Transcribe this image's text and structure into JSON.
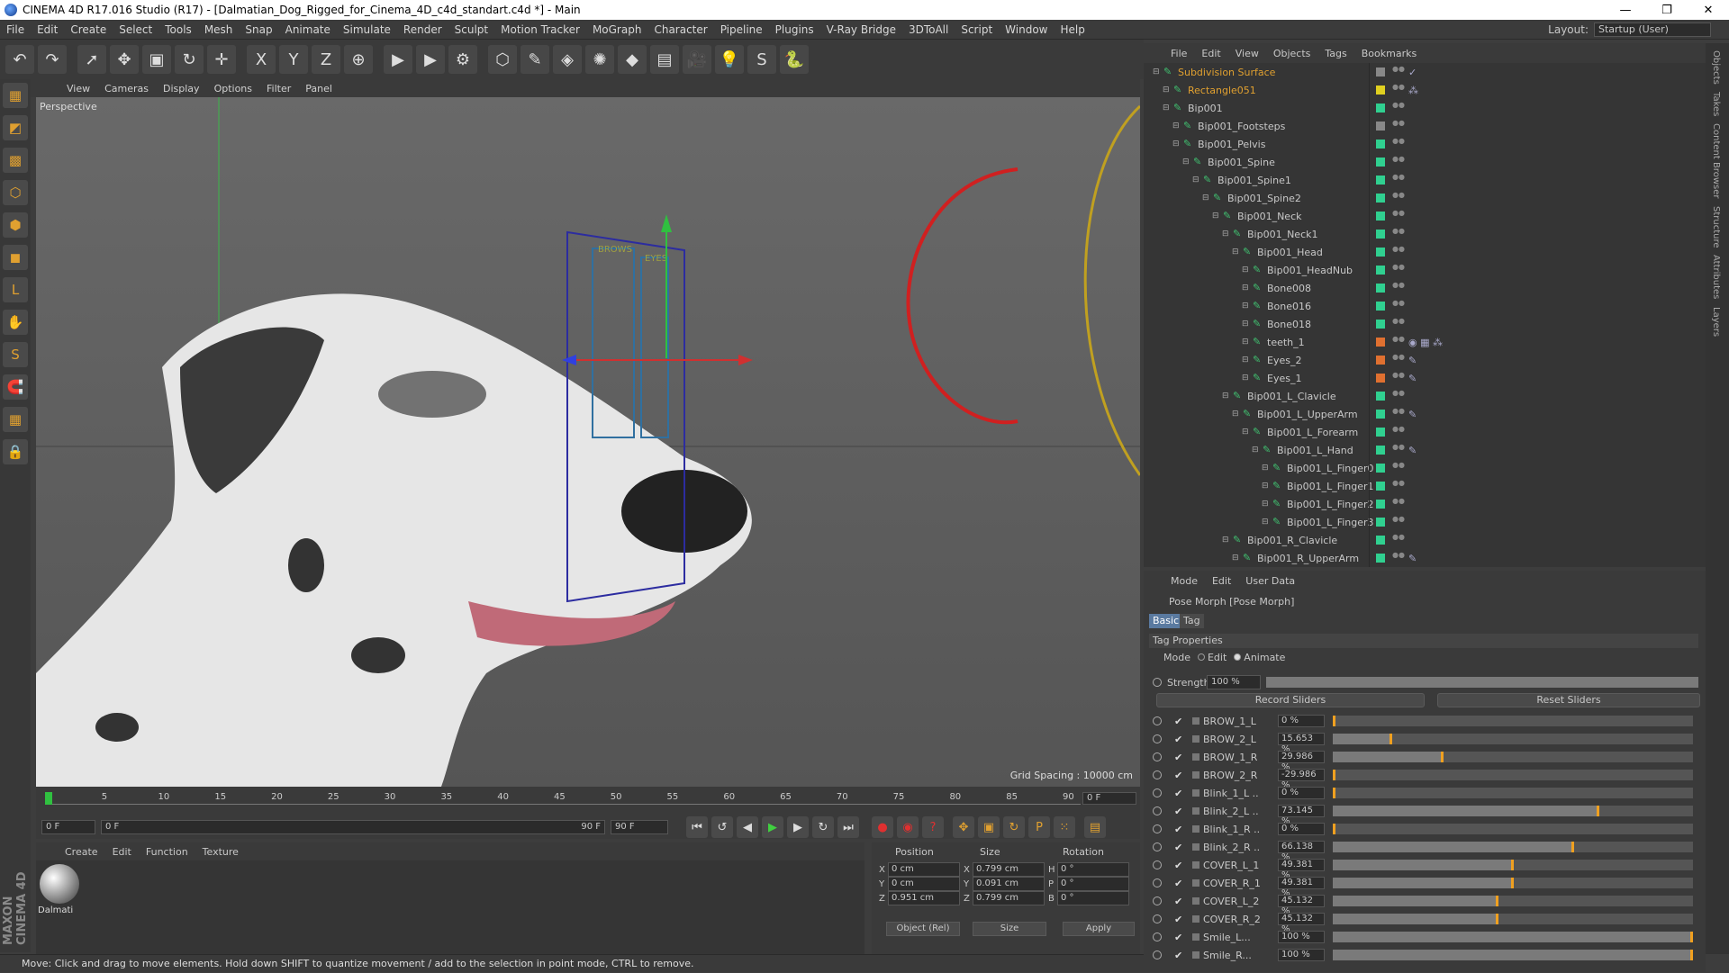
{
  "window": {
    "title": "CINEMA 4D R17.016 Studio (R17) - [Dalmatian_Dog_Rigged_for_Cinema_4D_c4d_standart.c4d *] - Main",
    "controls": [
      "—",
      "❐",
      "✕"
    ]
  },
  "menubar": {
    "items": [
      "File",
      "Edit",
      "Create",
      "Select",
      "Tools",
      "Mesh",
      "Snap",
      "Animate",
      "Simulate",
      "Render",
      "Sculpt",
      "Motion Tracker",
      "MoGraph",
      "Character",
      "Pipeline",
      "Plugins",
      "V-Ray Bridge",
      "3DToAll",
      "Script",
      "Window",
      "Help"
    ],
    "layout_label": "Layout:",
    "layout_value": "Startup (User)"
  },
  "toolbar": {
    "icons": [
      "undo-icon",
      "redo-icon",
      "select-icon",
      "move-icon",
      "scale-icon",
      "rotate-icon",
      "move-all-icon",
      "x-axis-icon",
      "y-axis-icon",
      "z-axis-icon",
      "world-icon",
      "render-view-icon",
      "render-picture-icon",
      "render-settings-icon",
      "cube-icon",
      "pen-icon",
      "subdivision-icon",
      "array-icon",
      "deformer-icon",
      "floor-icon",
      "camera-icon",
      "light-icon",
      "sculpt-icon",
      "python-icon"
    ],
    "glyphs": [
      "↶",
      "↷",
      "➚",
      "✥",
      "▣",
      "↻",
      "✛",
      "X",
      "Y",
      "Z",
      "⊕",
      "▶",
      "▶",
      "⚙",
      "⬡",
      "✎",
      "◈",
      "✺",
      "◆",
      "▤",
      "🎥",
      "💡",
      "S",
      "🐍"
    ]
  },
  "leftbar": {
    "icons": [
      "model-icon",
      "texture-icon",
      "uv-icon",
      "points-icon",
      "edges-icon",
      "polygons-icon",
      "axis-icon",
      "tweak-icon",
      "snap-icon",
      "magnet-icon",
      "workplane-icon",
      "lock-icon"
    ],
    "glyphs": [
      "▦",
      "◩",
      "▩",
      "⬡",
      "⬢",
      "◼",
      "L",
      "✋",
      "S",
      "🧲",
      "▦",
      "🔒"
    ]
  },
  "viewport": {
    "menu": [
      "View",
      "Cameras",
      "Display",
      "Options",
      "Filter",
      "Panel"
    ],
    "label": "Perspective",
    "grid_spacing": "Grid Spacing : 10000 cm",
    "rig_labels": [
      "BROWS",
      "EYES"
    ]
  },
  "timeline": {
    "ticks": [
      "0",
      "5",
      "10",
      "15",
      "20",
      "25",
      "30",
      "35",
      "40",
      "45",
      "50",
      "55",
      "60",
      "65",
      "70",
      "75",
      "80",
      "85",
      "90"
    ],
    "current_frame": "0 F",
    "start": "0 F",
    "range_start": "0 F",
    "range_end": "90 F",
    "end": "90 F"
  },
  "material": {
    "menu": [
      "Create",
      "Edit",
      "Function",
      "Texture"
    ],
    "name": "Dalmati",
    "brand": "MAXON CINEMA 4D"
  },
  "coordinates": {
    "headers": [
      "Position",
      "Size",
      "Rotation"
    ],
    "rows": [
      {
        "axis": "X",
        "pos": "0 cm",
        "size_axis": "X",
        "size": "0.799 cm",
        "rot_axis": "H",
        "rot": "0 °"
      },
      {
        "axis": "Y",
        "pos": "0 cm",
        "size_axis": "Y",
        "size": "0.091 cm",
        "rot_axis": "P",
        "rot": "0 °"
      },
      {
        "axis": "Z",
        "pos": "0.951 cm",
        "size_axis": "Z",
        "size": "0.799 cm",
        "rot_axis": "B",
        "rot": "0 °"
      }
    ],
    "mode": "Object (Rel)",
    "size_mode": "Size",
    "apply": "Apply"
  },
  "status": "Move: Click and drag to move elements. Hold down SHIFT to quantize movement / add to the selection in point mode, CTRL to remove.",
  "objects": {
    "menu": [
      "File",
      "Edit",
      "View",
      "Objects",
      "Tags",
      "Bookmarks"
    ],
    "rows": [
      {
        "name": "Subdivision Surface",
        "depth": 0,
        "color": "#e0a030",
        "swatch": "#888888",
        "tag": "✓"
      },
      {
        "name": "Rectangle051",
        "depth": 1,
        "color": "#e0a030",
        "swatch": "#e0d020",
        "tag": "⁂"
      },
      {
        "name": "Bip001",
        "depth": 1,
        "color": "#c8c8c8",
        "swatch": "#30d090",
        "tag": ""
      },
      {
        "name": "Bip001_Footsteps",
        "depth": 2,
        "color": "#c8c8c8",
        "swatch": "#888888",
        "tag": ""
      },
      {
        "name": "Bip001_Pelvis",
        "depth": 2,
        "color": "#c8c8c8",
        "swatch": "#30d090",
        "tag": ""
      },
      {
        "name": "Bip001_Spine",
        "depth": 3,
        "color": "#c8c8c8",
        "swatch": "#30d090",
        "tag": ""
      },
      {
        "name": "Bip001_Spine1",
        "depth": 4,
        "color": "#c8c8c8",
        "swatch": "#30d090",
        "tag": ""
      },
      {
        "name": "Bip001_Spine2",
        "depth": 5,
        "color": "#c8c8c8",
        "swatch": "#30d090",
        "tag": ""
      },
      {
        "name": "Bip001_Neck",
        "depth": 6,
        "color": "#c8c8c8",
        "swatch": "#30d090",
        "tag": ""
      },
      {
        "name": "Bip001_Neck1",
        "depth": 7,
        "color": "#c8c8c8",
        "swatch": "#30d090",
        "tag": ""
      },
      {
        "name": "Bip001_Head",
        "depth": 8,
        "color": "#c8c8c8",
        "swatch": "#30d090",
        "tag": ""
      },
      {
        "name": "Bip001_HeadNub",
        "depth": 9,
        "color": "#c8c8c8",
        "swatch": "#30d090",
        "tag": ""
      },
      {
        "name": "Bone008",
        "depth": 9,
        "color": "#c8c8c8",
        "swatch": "#30d090",
        "tag": ""
      },
      {
        "name": "Bone016",
        "depth": 9,
        "color": "#c8c8c8",
        "swatch": "#30d090",
        "tag": ""
      },
      {
        "name": "Bone018",
        "depth": 9,
        "color": "#c8c8c8",
        "swatch": "#30d090",
        "tag": ""
      },
      {
        "name": "teeth_1",
        "depth": 9,
        "color": "#c8c8c8",
        "swatch": "#e07030",
        "tag": "◉ ▦ ⁂"
      },
      {
        "name": "Eyes_2",
        "depth": 9,
        "color": "#c8c8c8",
        "swatch": "#e07030",
        "tag": "✎"
      },
      {
        "name": "Eyes_1",
        "depth": 9,
        "color": "#c8c8c8",
        "swatch": "#e07030",
        "tag": "✎"
      },
      {
        "name": "Bip001_L_Clavicle",
        "depth": 7,
        "color": "#c8c8c8",
        "swatch": "#30d090",
        "tag": ""
      },
      {
        "name": "Bip001_L_UpperArm",
        "depth": 8,
        "color": "#c8c8c8",
        "swatch": "#30d090",
        "tag": "✎"
      },
      {
        "name": "Bip001_L_Forearm",
        "depth": 9,
        "color": "#c8c8c8",
        "swatch": "#30d090",
        "tag": ""
      },
      {
        "name": "Bip001_L_Hand",
        "depth": 10,
        "color": "#c8c8c8",
        "swatch": "#30d090",
        "tag": "✎"
      },
      {
        "name": "Bip001_L_Finger0",
        "depth": 11,
        "color": "#c8c8c8",
        "swatch": "#30d090",
        "tag": ""
      },
      {
        "name": "Bip001_L_Finger1",
        "depth": 11,
        "color": "#c8c8c8",
        "swatch": "#30d090",
        "tag": ""
      },
      {
        "name": "Bip001_L_Finger2",
        "depth": 11,
        "color": "#c8c8c8",
        "swatch": "#30d090",
        "tag": ""
      },
      {
        "name": "Bip001_L_Finger3",
        "depth": 11,
        "color": "#c8c8c8",
        "swatch": "#30d090",
        "tag": ""
      },
      {
        "name": "Bip001_R_Clavicle",
        "depth": 7,
        "color": "#c8c8c8",
        "swatch": "#30d090",
        "tag": ""
      },
      {
        "name": "Bip001_R_UpperArm",
        "depth": 8,
        "color": "#c8c8c8",
        "swatch": "#30d090",
        "tag": "✎"
      }
    ]
  },
  "right_tabs": [
    "Objects",
    "Takes",
    "Content Browser",
    "Structure",
    "Attributes",
    "Layers"
  ],
  "attributes": {
    "menu": [
      "Mode",
      "Edit",
      "User Data"
    ],
    "title": "Pose Morph [Pose Morph]",
    "tabs": [
      "Basic",
      "Tag"
    ],
    "section": "Tag Properties",
    "mode_label": "Mode",
    "mode_edit": "Edit",
    "mode_animate": "Animate",
    "strength_label": "Strength",
    "strength_value": "100 %",
    "strength_fraction": 1.0,
    "record_sliders": "Record Sliders",
    "reset_sliders": "Reset Sliders",
    "morphs": [
      {
        "name": "BROW_1_L",
        "value": "0 %",
        "fraction": 0.0
      },
      {
        "name": "BROW_2_L",
        "value": "15.653 %",
        "fraction": 0.15653
      },
      {
        "name": "BROW_1_R",
        "value": "29.986 %",
        "fraction": 0.29986
      },
      {
        "name": "BROW_2_R",
        "value": "-29.986 %",
        "fraction": 0.0
      },
      {
        "name": "Blink_1_L ..",
        "value": "0 %",
        "fraction": 0.0
      },
      {
        "name": "Blink_2_L ..",
        "value": "73.145 %",
        "fraction": 0.73145
      },
      {
        "name": "Blink_1_R ..",
        "value": "0 %",
        "fraction": 0.0
      },
      {
        "name": "Blink_2_R ..",
        "value": "66.138 %",
        "fraction": 0.66138
      },
      {
        "name": "COVER_L_1",
        "value": "49.381 %",
        "fraction": 0.49381
      },
      {
        "name": "COVER_R_1",
        "value": "49.381 %",
        "fraction": 0.49381
      },
      {
        "name": "COVER_L_2",
        "value": "45.132 %",
        "fraction": 0.45132
      },
      {
        "name": "COVER_R_2",
        "value": "45.132 %",
        "fraction": 0.45132
      },
      {
        "name": "Smile_L...",
        "value": "100 %",
        "fraction": 1.0
      },
      {
        "name": "Smile_R...",
        "value": "100 %",
        "fraction": 1.0
      }
    ]
  }
}
